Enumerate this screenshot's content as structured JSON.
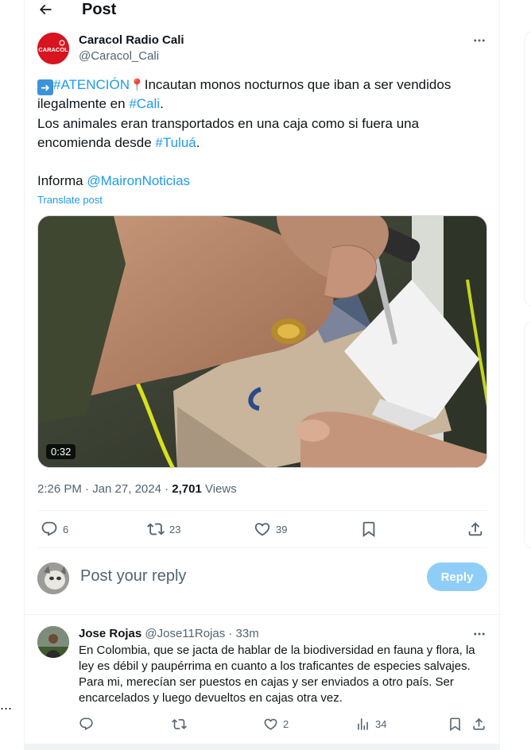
{
  "header": {
    "title": "Post"
  },
  "tweet": {
    "author_name": "Caracol Radio Cali",
    "author_handle": "@Caracol_Cali",
    "avatar_text": "CARACOL",
    "line1_tag": "#ATENCIÓN",
    "line1_rest": "Incautan monos nocturnos que iban a ser vendidos",
    "line2_pre": "ilegalmente en ",
    "line2_tag": "#Cali",
    "line2_post": ".",
    "line3": "Los animales eran transportados en una caja como si fuera una",
    "line4_pre": "encomienda desde ",
    "line4_tag": "#Tuluá",
    "line4_post": ".",
    "line5_pre": "Informa ",
    "line5_mention": "@MaironNoticias",
    "translate": "Translate post",
    "video_duration": "0:32",
    "time": "2:26 PM · Jan 27, 2024 · ",
    "views_count": "2,701",
    "views_label": " Views"
  },
  "actions": {
    "replies": "6",
    "reposts": "23",
    "likes": "39"
  },
  "composer": {
    "placeholder": "Post your reply",
    "button": "Reply"
  },
  "comment": {
    "name": "Jose Rojas",
    "handle": "@Jose11Rojas · 33m",
    "lines": [
      "En Colombia, que se jacta de hablar de la biodiversidad en fauna y flora, la",
      "ley es débil y paupérrima en cuanto a los traficantes de especies salvajes.",
      "Para mi, merecían ser puestos en cajas y ser enviados a otro país. Ser",
      "encarcelados y luego devueltos en cajas otra vez."
    ],
    "likes": "2",
    "views": "34"
  },
  "left_panel": {
    "ellipsis": "..."
  },
  "colors": {
    "accent": "#1d9bf0",
    "reply_disabled": "#8ecdf8",
    "muted": "#536471",
    "brand_red": "#d7141f"
  }
}
